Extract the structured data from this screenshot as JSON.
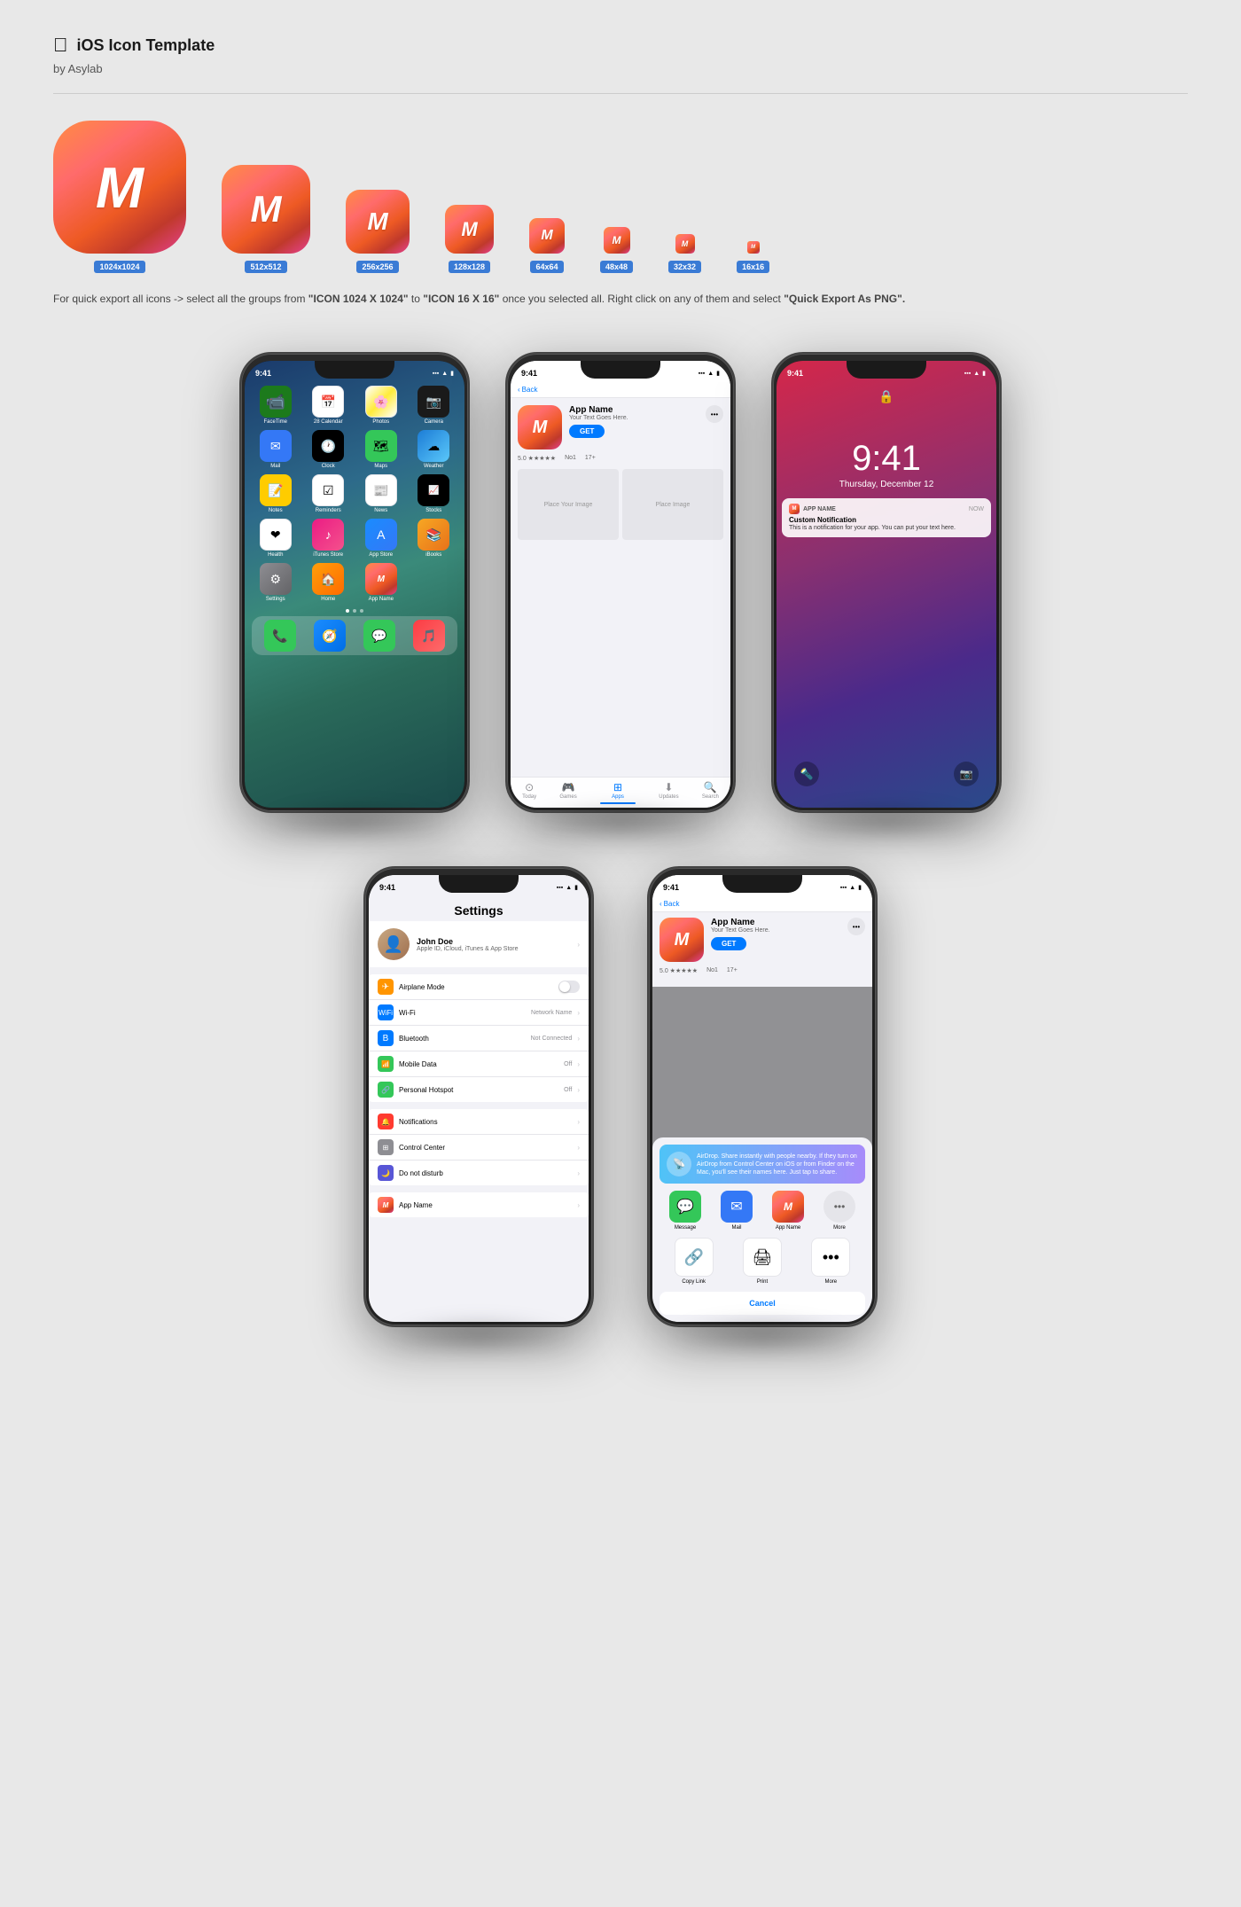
{
  "header": {
    "apple_logo": "",
    "title": "iOS Icon Template",
    "subtitle": "by Asylab"
  },
  "icon_sizes": [
    {
      "size": 1024,
      "label": "1024x1024",
      "font_size": "60px",
      "icon_size": "150px",
      "border_radius": "28%"
    },
    {
      "size": 512,
      "label": "512x512",
      "font_size": "40px",
      "icon_size": "100px",
      "border_radius": "23%"
    },
    {
      "size": 256,
      "label": "256x256",
      "font_size": "26px",
      "icon_size": "72px",
      "border_radius": "22%"
    },
    {
      "size": 128,
      "label": "128x128",
      "font_size": "18px",
      "icon_size": "55px",
      "border_radius": "22%"
    },
    {
      "size": 64,
      "label": "64x64",
      "font_size": "12px",
      "icon_size": "40px",
      "border_radius": "22%"
    },
    {
      "size": 48,
      "label": "48x48",
      "font_size": "10px",
      "icon_size": "30px",
      "border_radius": "22%"
    },
    {
      "size": 32,
      "label": "32x32",
      "font_size": "7px",
      "icon_size": "22px",
      "border_radius": "22%"
    },
    {
      "size": 16,
      "label": "16x16",
      "font_size": "5px",
      "icon_size": "14px",
      "border_radius": "22%"
    }
  ],
  "export_instruction": "For quick export all icons -> select all the groups from ",
  "export_from": "\"ICON 1024 X 1024\"",
  "export_to": " to ",
  "export_to_label": "\"ICON 16 X 16\"",
  "export_suffix": " once you selected all. Right click on any of them and select ",
  "export_action": "\"Quick Export As PNG\".",
  "phone1": {
    "status_time": "9:41",
    "screen_type": "home"
  },
  "phone2": {
    "status_time": "9:41",
    "screen_type": "appstore",
    "app_name": "App Name",
    "app_tagline": "Your Text Goes Here.",
    "get_label": "GET",
    "back_label": "Back",
    "rating": "5.0 ★★★★★",
    "category": "No1",
    "age": "17+",
    "placeholder1": "Place Your Image",
    "placeholder2": "Place Image",
    "tabs": [
      "Today",
      "Games",
      "Apps",
      "Updates",
      "Search"
    ]
  },
  "phone3": {
    "status_time": "9:41",
    "screen_type": "lockscreen",
    "time_display": "9:41",
    "date_display": "Thursday, December 12",
    "notif_app": "APP NAME",
    "notif_time": "NOW",
    "notif_title": "Custom Notification",
    "notif_body": "This is a notification for your app. You can put your text here."
  },
  "phone4": {
    "status_time": "9:41",
    "screen_type": "settings",
    "title": "Settings",
    "profile_name": "John Doe",
    "profile_sub": "Apple ID, iCloud, iTunes & App Store",
    "rows": [
      {
        "label": "Airplane Mode",
        "value": "",
        "icon_bg": "#ff9500",
        "icon": "✈"
      },
      {
        "label": "Wi-Fi",
        "value": "Network Name",
        "icon_bg": "#007aff",
        "icon": "📶"
      },
      {
        "label": "Bluetooth",
        "value": "Not Connected",
        "icon_bg": "#007aff",
        "icon": "⬡"
      },
      {
        "label": "Mobile Data",
        "value": "Off",
        "icon_bg": "#34c759",
        "icon": "📱"
      },
      {
        "label": "Personal Hotspot",
        "value": "Off",
        "icon_bg": "#34c759",
        "icon": "🔗"
      },
      {
        "label": "Notifications",
        "value": "",
        "icon_bg": "#ff3b30",
        "icon": "🔔"
      },
      {
        "label": "Control Center",
        "value": "",
        "icon_bg": "#8e8e93",
        "icon": "⊞"
      },
      {
        "label": "Do not disturb",
        "value": "",
        "icon_bg": "#5856d6",
        "icon": "🌙"
      },
      {
        "label": "App Name",
        "value": "",
        "icon_bg": null,
        "icon": "M"
      }
    ]
  },
  "phone5": {
    "status_time": "9:41",
    "screen_type": "share",
    "app_name": "App Name",
    "app_tagline": "Your Text Goes Here.",
    "get_label": "GET",
    "back_label": "Back",
    "airdrop_text": "AirDrop. Share instantly with people nearby. If they turn on AirDrop from Control Center on iOS or from Finder on the Mac, you'll see their names here. Just tap to share.",
    "share_apps": [
      "Message",
      "Mail",
      "App Name",
      "More"
    ],
    "share_actions": [
      "Copy Link",
      "Print",
      "More"
    ],
    "cancel_label": "Cancel"
  },
  "colors": {
    "accent": "#007aff",
    "badge_blue": "#3a7bd5",
    "icon_gradient_start": "#ff8c42",
    "icon_gradient_end": "#e84393"
  }
}
